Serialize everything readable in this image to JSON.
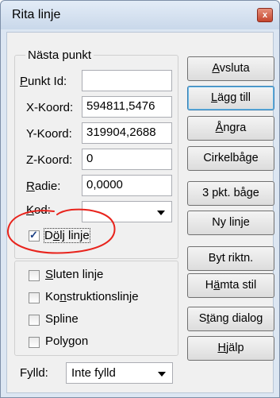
{
  "window": {
    "title": "Rita linje",
    "close_symbol": "x"
  },
  "next_point": {
    "legend": "Nästa punkt",
    "rows": [
      {
        "label": "Punkt Id:",
        "value": ""
      },
      {
        "label": "X-Koord:",
        "value": "594811,5476"
      },
      {
        "label": "Y-Koord:",
        "value": "319904,2688"
      },
      {
        "label": "Z-Koord:",
        "value": "0"
      },
      {
        "label": "Radie:",
        "value": "0,0000"
      }
    ],
    "kod_label": "Kod:",
    "kod_value": ""
  },
  "options": [
    {
      "label": "Dölj linje",
      "checked": true
    },
    {
      "label": "Sluten linje",
      "checked": false
    },
    {
      "label": "Konstruktionslinje",
      "checked": false
    },
    {
      "label": "Spline",
      "checked": false
    },
    {
      "label": "Polygon",
      "checked": false
    }
  ],
  "fill": {
    "label": "Fylld:",
    "value": "Inte fylld"
  },
  "buttons": [
    "Avsluta",
    "Lägg till",
    "Ångra",
    "Cirkelbåge",
    "3 pkt. båge",
    "Ny linje",
    "Byt riktn.",
    "Hämta stil",
    "Stäng dialog",
    "Hjälp"
  ],
  "annotation": {
    "color": "#e8231c"
  },
  "check_mark": "✓"
}
